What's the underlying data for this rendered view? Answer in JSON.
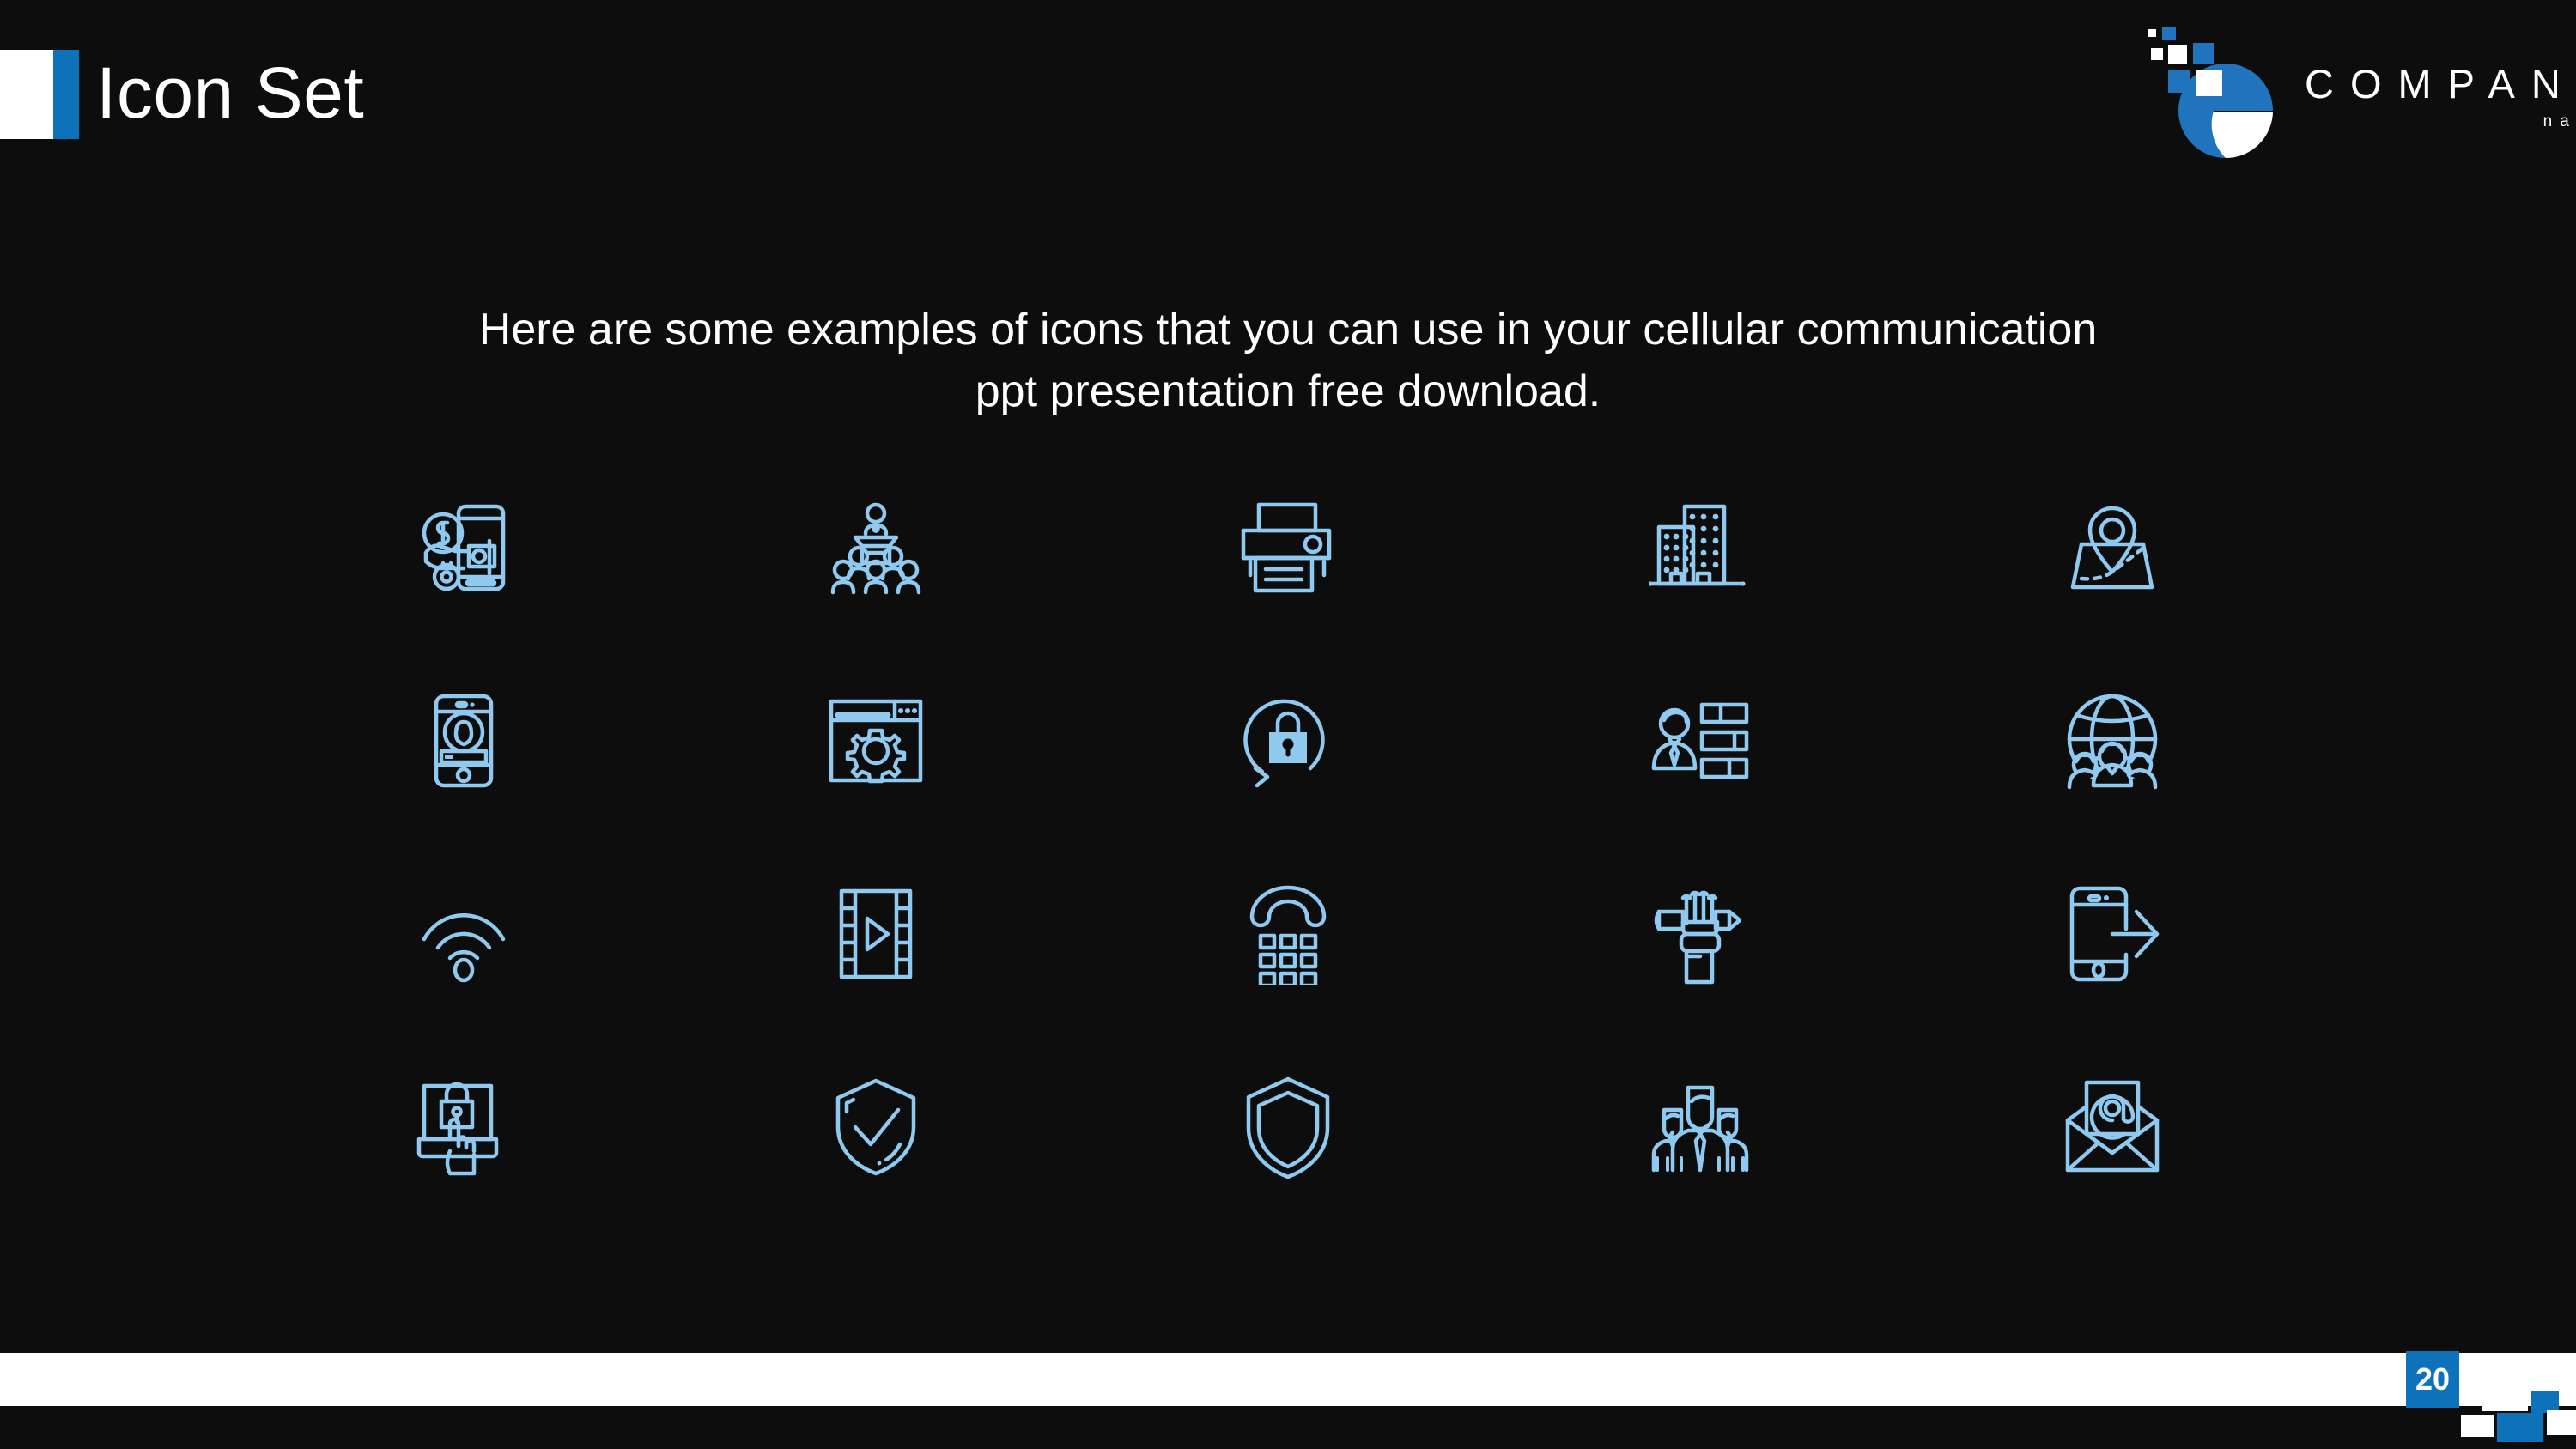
{
  "slide": {
    "title": "Icon Set",
    "subtitle": "Here are some examples of icons that you can use in your cellular communication ppt presentation free download.",
    "page_number": "20",
    "background_color": "#0d0d0d",
    "accent_color": "#0d72b9",
    "icon_color": "#8fc9f0"
  },
  "logo": {
    "company": "COMPANY",
    "name": "name"
  },
  "icons": [
    {
      "name": "mobile-payment-icon",
      "label": "Mobile payment"
    },
    {
      "name": "presentation-audience-icon",
      "label": "Presentation audience"
    },
    {
      "name": "printer-icon",
      "label": "Printer"
    },
    {
      "name": "office-buildings-icon",
      "label": "Office buildings"
    },
    {
      "name": "map-location-pin-icon",
      "label": "Map location pin"
    },
    {
      "name": "mobile-user-profile-icon",
      "label": "Mobile user profile"
    },
    {
      "name": "browser-settings-icon",
      "label": "Browser settings"
    },
    {
      "name": "lock-refresh-icon",
      "label": "Security reset lock"
    },
    {
      "name": "businessman-data-icon",
      "label": "Businessman with data bars"
    },
    {
      "name": "global-team-icon",
      "label": "Global team"
    },
    {
      "name": "wifi-signal-icon",
      "label": "Wi-Fi signal"
    },
    {
      "name": "video-film-play-icon",
      "label": "Video film play"
    },
    {
      "name": "telephone-keypad-icon",
      "label": "Telephone keypad"
    },
    {
      "name": "hand-pencil-icon",
      "label": "Hand holding pencil"
    },
    {
      "name": "mobile-send-arrow-icon",
      "label": "Mobile send arrow"
    },
    {
      "name": "secure-laptop-touch-icon",
      "label": "Secure laptop touch"
    },
    {
      "name": "shield-check-icon",
      "label": "Shield check"
    },
    {
      "name": "shield-icon",
      "label": "Shield"
    },
    {
      "name": "team-group-icon",
      "label": "Team group"
    },
    {
      "name": "email-envelope-icon",
      "label": "Email envelope"
    }
  ]
}
